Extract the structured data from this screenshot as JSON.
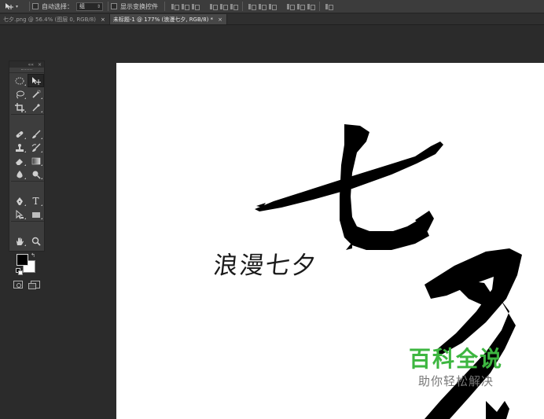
{
  "options_bar": {
    "tool_preset_icon": "move-tool-icon",
    "auto_select_label": "自动选择：",
    "auto_select_value": "组",
    "show_transform_label": "显示变换控件"
  },
  "tabs": [
    {
      "label": "七夕.png @ 56.4% (图层 0, RGB/8)",
      "close": "×"
    },
    {
      "label": "未标题-1 @ 177% (浪漫七夕, RGB/8) *",
      "close": "×"
    }
  ],
  "tools_panel": {
    "header_collapse": "««",
    "header_close": "×",
    "tools": [
      {
        "name": "marquee-tool-icon"
      },
      {
        "name": "move-tool-icon"
      },
      {
        "name": "lasso-tool-icon"
      },
      {
        "name": "quick-selection-tool-icon"
      },
      {
        "name": "crop-tool-icon"
      },
      {
        "name": "eyedropper-tool-icon"
      },
      {
        "name": "spot-healing-brush-icon"
      },
      {
        "name": "brush-tool-icon"
      },
      {
        "name": "clone-stamp-icon"
      },
      {
        "name": "history-brush-icon"
      },
      {
        "name": "eraser-tool-icon"
      },
      {
        "name": "gradient-tool-icon"
      },
      {
        "name": "blur-tool-icon"
      },
      {
        "name": "dodge-tool-icon"
      },
      {
        "name": "pen-tool-icon"
      },
      {
        "name": "type-tool-icon",
        "glyph": "T"
      },
      {
        "name": "path-selection-icon"
      },
      {
        "name": "rectangle-tool-icon"
      },
      {
        "name": "hand-tool-icon"
      },
      {
        "name": "zoom-tool-icon"
      }
    ],
    "foreground_color": "#000000",
    "background_color": "#ffffff"
  },
  "canvas": {
    "subtitle": "浪漫七夕",
    "calligraphy_chars": "七夕"
  },
  "watermark": {
    "title": "百科全说",
    "subtitle": "助你轻松解决",
    "title_color": "#3db640"
  }
}
